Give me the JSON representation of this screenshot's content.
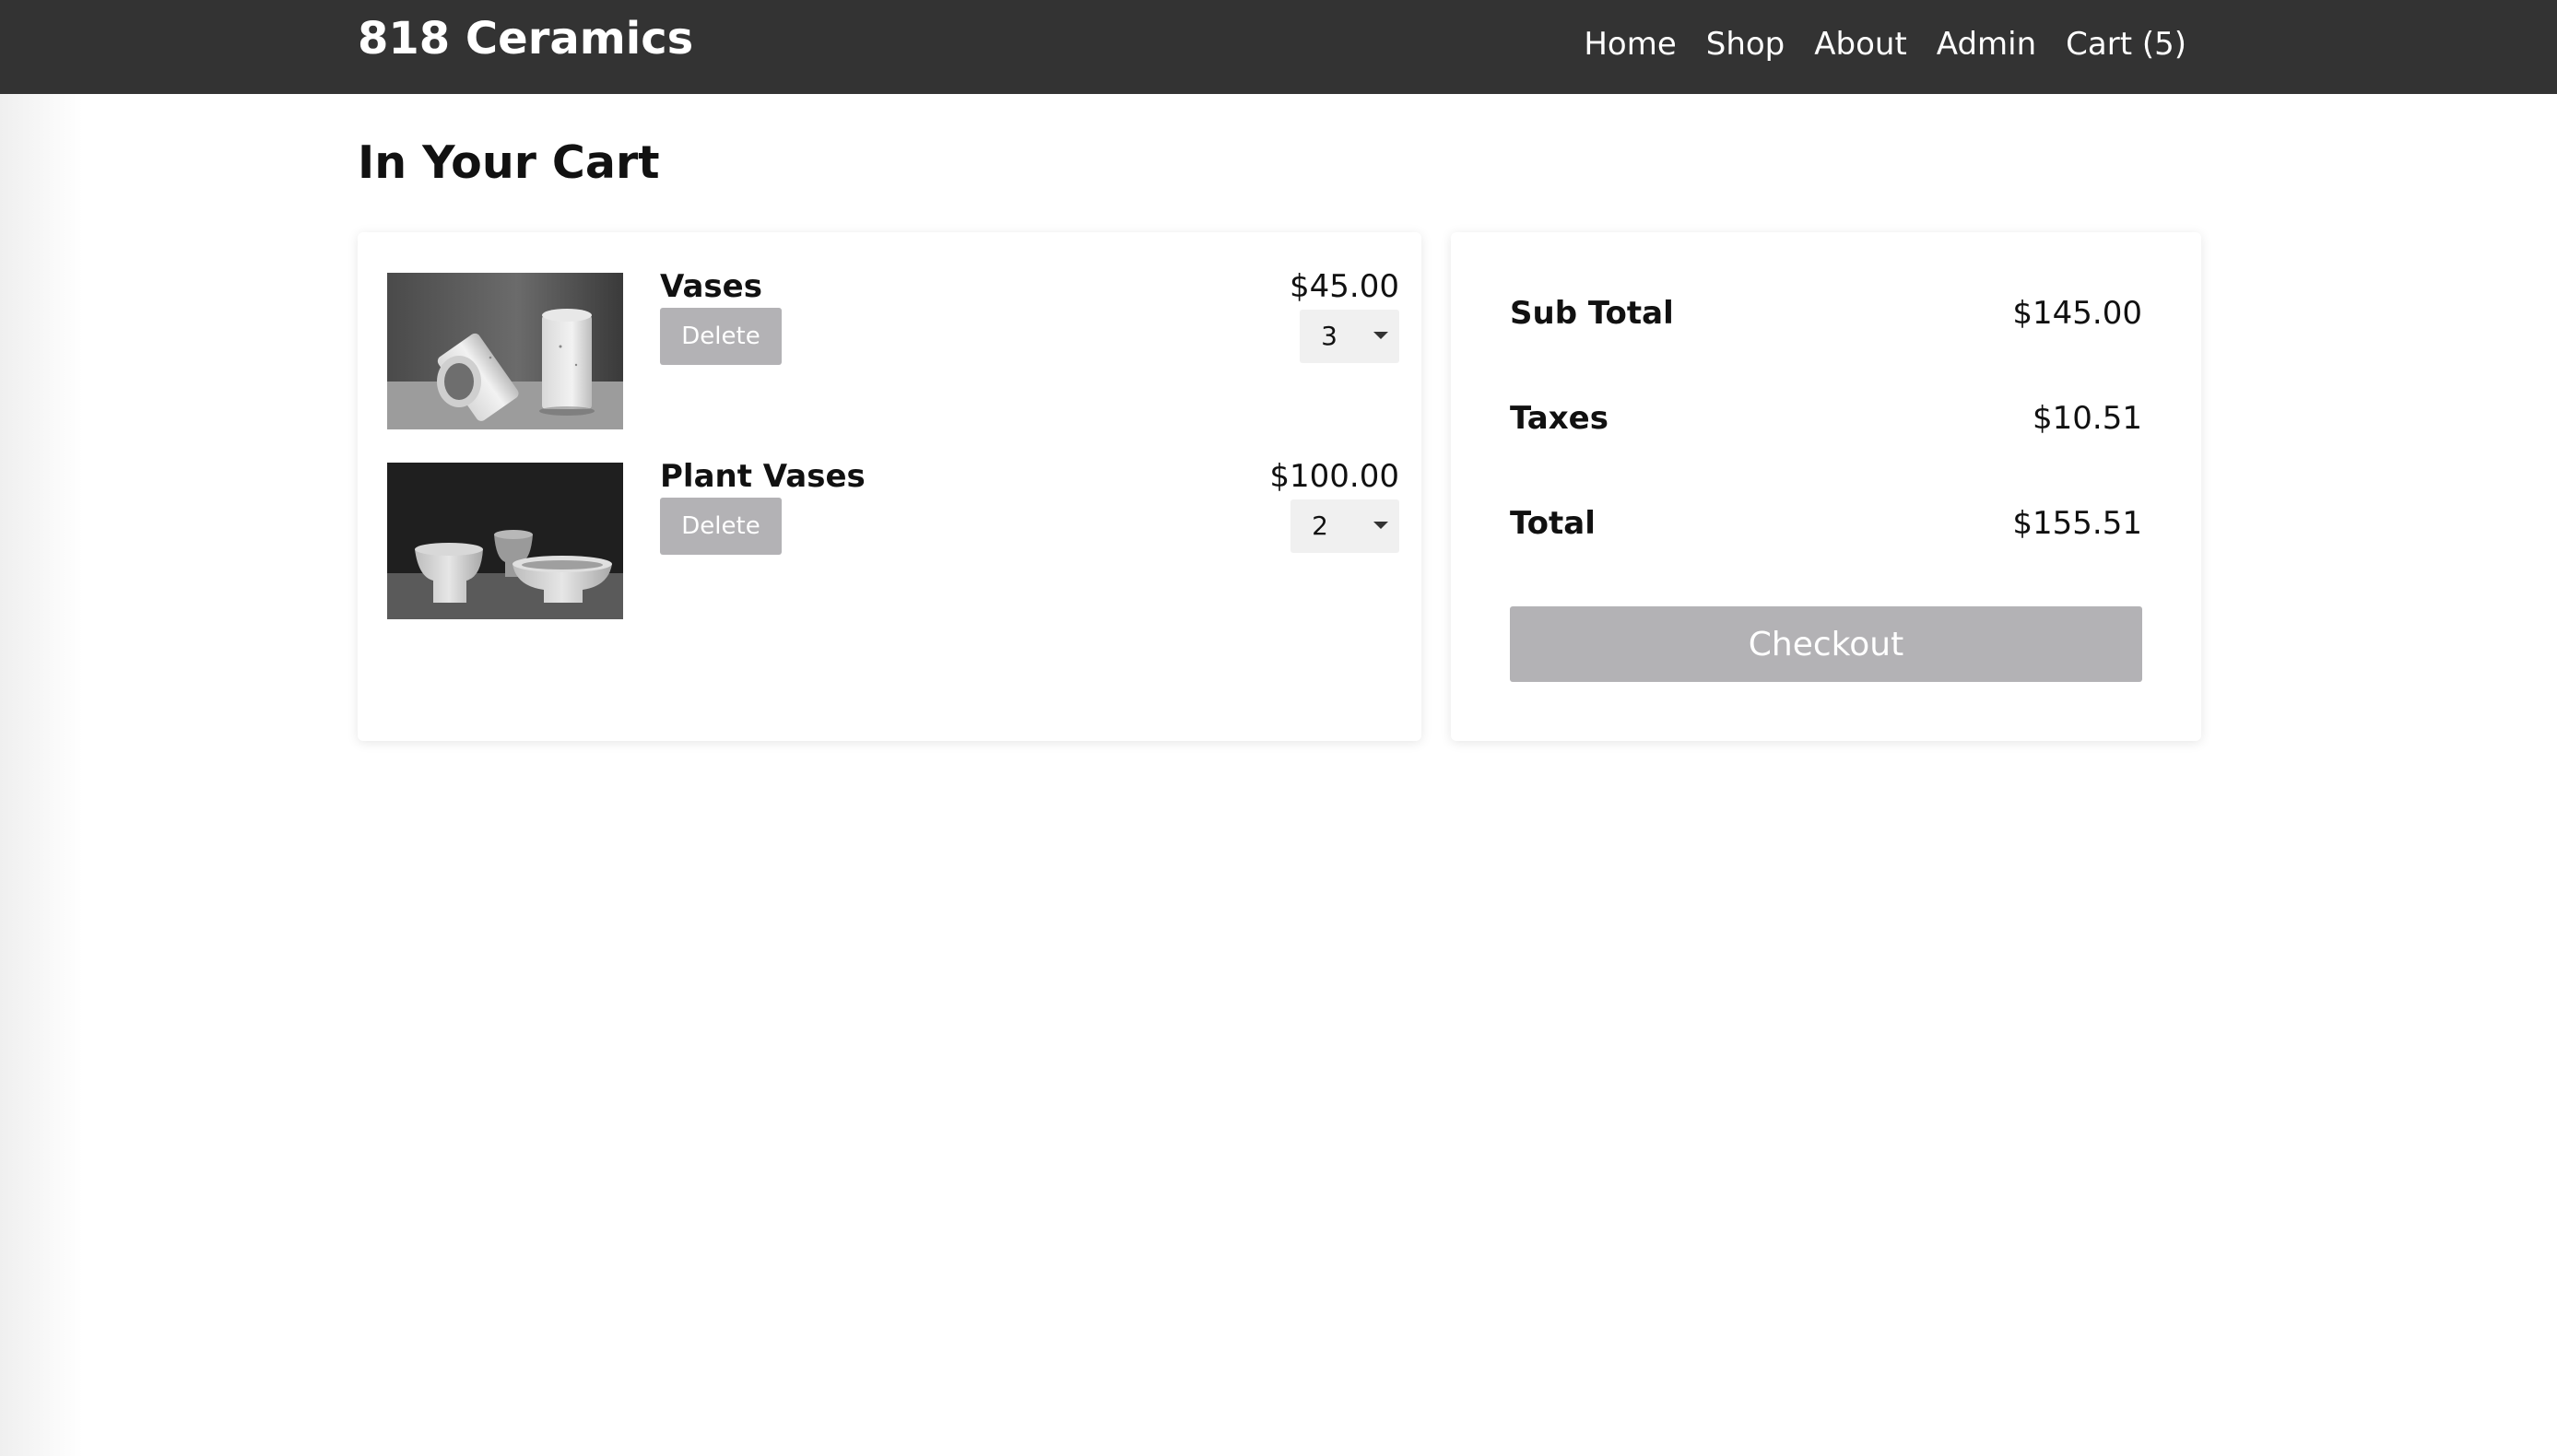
{
  "header": {
    "brand": "818 Ceramics",
    "nav": [
      {
        "label": "Home"
      },
      {
        "label": "Shop"
      },
      {
        "label": "About"
      },
      {
        "label": "Admin"
      },
      {
        "label": "Cart (5)"
      }
    ]
  },
  "page": {
    "title": "In Your Cart"
  },
  "cart": {
    "items": [
      {
        "name": "Vases",
        "price": "$45.00",
        "quantity": "3",
        "delete_label": "Delete",
        "image_icon": "vases-photo"
      },
      {
        "name": "Plant Vases",
        "price": "$100.00",
        "quantity": "2",
        "delete_label": "Delete",
        "image_icon": "plant-vases-photo"
      }
    ]
  },
  "summary": {
    "subtotal_label": "Sub Total",
    "subtotal_value": "$145.00",
    "taxes_label": "Taxes",
    "taxes_value": "$10.51",
    "total_label": "Total",
    "total_value": "$155.51",
    "checkout_label": "Checkout"
  },
  "colors": {
    "navbar": "#333333",
    "button_disabled": "#b3b2b5",
    "qty_background": "#f0f0f0"
  }
}
